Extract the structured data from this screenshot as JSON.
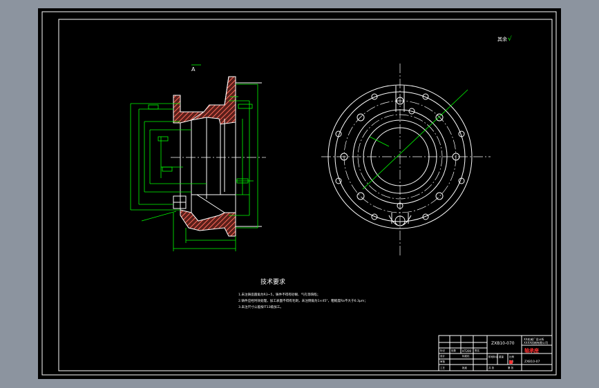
{
  "drawing": {
    "section_mark": "A",
    "roughness_note": "其余",
    "roughness_symbol": "√",
    "tech_requirements": {
      "title": "技术要求",
      "items": [
        "1.未注铸造圆角为R3~5，铸件不得有砂眼、气孔等缺陷；",
        "2.铸件应经时效处理，加工表面不得有毛刺，未注倒角为1×45°，粗糙度Ra不大于6.3μm；",
        "3.未注尺寸公差按IT13级加工。"
      ]
    },
    "title_block": {
      "drawing_no": "ZXB10-070",
      "part_name": "轴承座",
      "company_line1": "XX机械厂设计所",
      "company_line2": "XXXX机械有限公司",
      "material": "HT200",
      "scale": "1:1",
      "sheet_no": "ZXB10-07",
      "labels": [
        "标记",
        "处数",
        "分区",
        "更改文件号",
        "签名",
        "年月日",
        "设计",
        "标准化",
        "审核",
        "工艺",
        "批准",
        "阶段标记",
        "重量",
        "比例",
        "共 张",
        "第 张"
      ]
    },
    "colors": {
      "background": "#000000",
      "outline": "#ffffff",
      "dimensions": "#00ff00",
      "hatch": "#ff6a5a",
      "part_name": "#ff3333",
      "frame": "#8c949f"
    }
  }
}
